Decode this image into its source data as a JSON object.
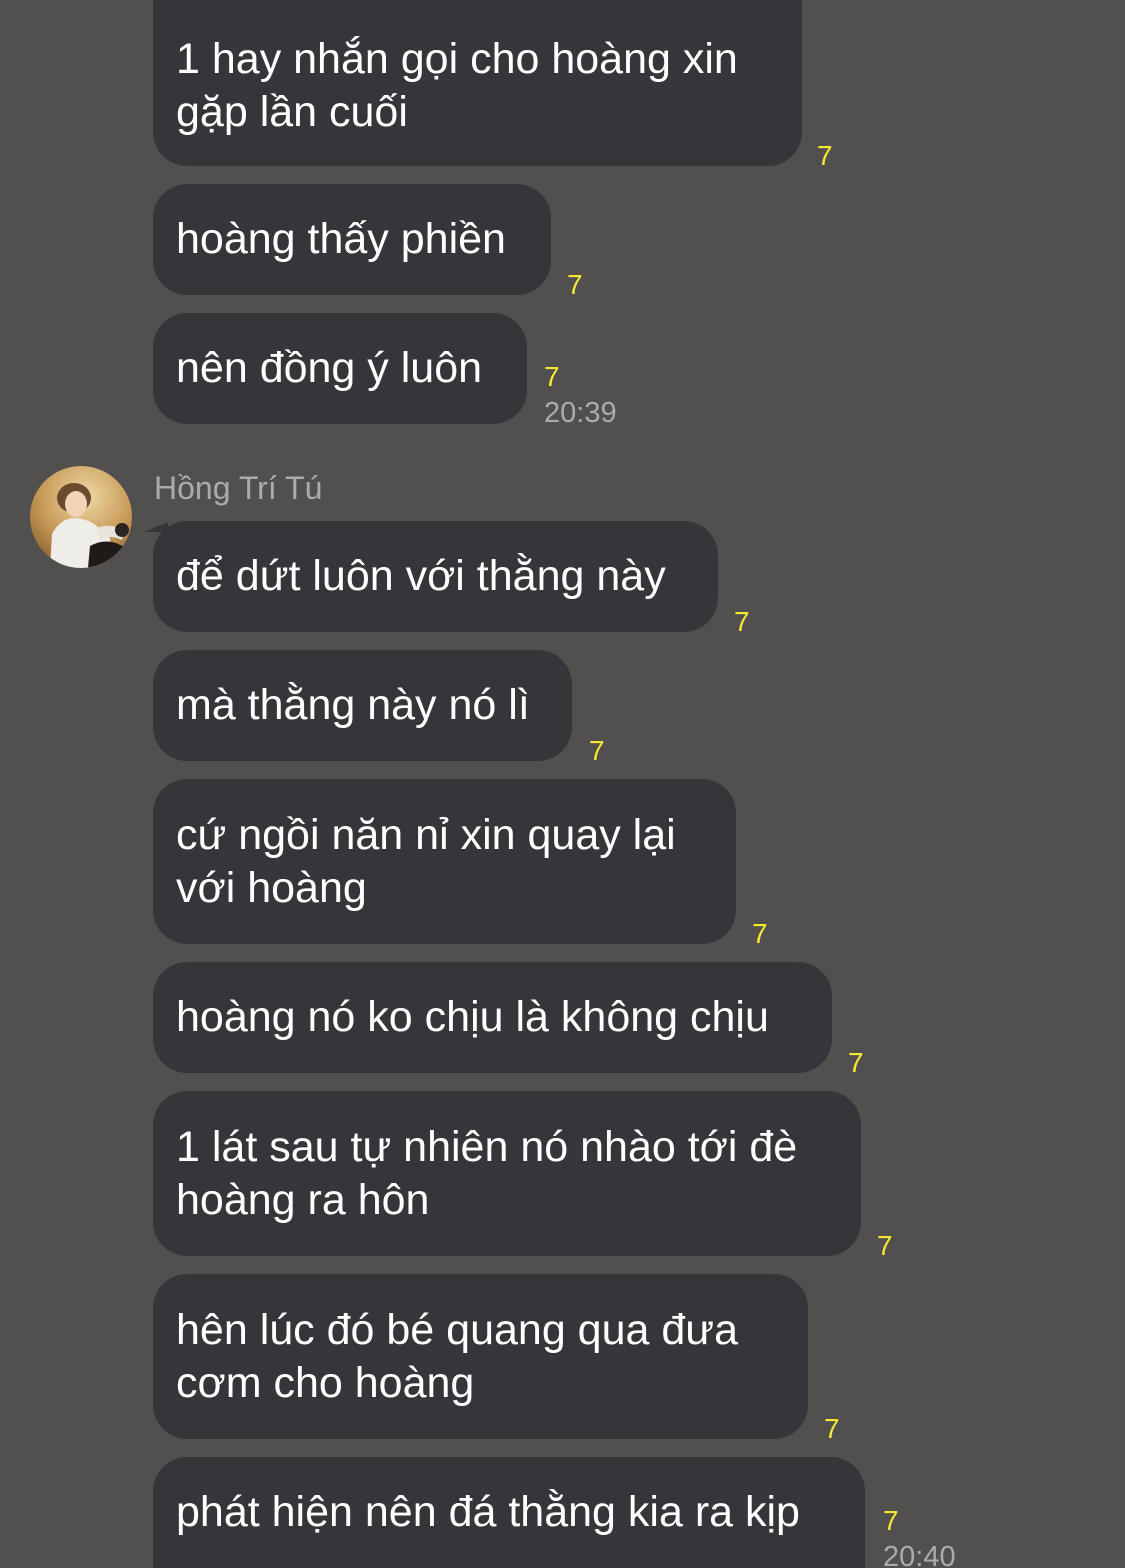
{
  "colors": {
    "background": "#524f4f",
    "bubble": "#36363a",
    "read_count": "#f5e832",
    "secondary_text": "#aeaaaa"
  },
  "messages_before": [
    {
      "text": "1 hay nhắn gọi cho hoàng xin\ngặp lần cuối",
      "read_count": "7"
    },
    {
      "text": "hoàng thấy phiền",
      "read_count": "7"
    },
    {
      "text": "nên đồng ý luôn",
      "read_count": "7",
      "time": "20:39"
    }
  ],
  "sender": {
    "name": "Hồng Trí Tú",
    "avatar_icon": "profile-photo"
  },
  "messages_after": [
    {
      "text": "để dứt luôn với thằng này",
      "read_count": "7"
    },
    {
      "text": "mà thằng này nó lì",
      "read_count": "7"
    },
    {
      "text": "cứ ngồi năn nỉ xin quay lại\nvới hoàng",
      "read_count": "7"
    },
    {
      "text": "hoàng nó ko chịu là không chịu",
      "read_count": "7"
    },
    {
      "text": "1 lát sau tự nhiên nó nhào tới đè\nhoàng ra hôn",
      "read_count": "7"
    },
    {
      "text": "hên lúc đó bé quang qua đưa\ncơm cho hoàng",
      "read_count": "7"
    },
    {
      "text": "phát hiện nên đá thằng kia ra kịp",
      "read_count": "7",
      "time": "20:40"
    }
  ]
}
